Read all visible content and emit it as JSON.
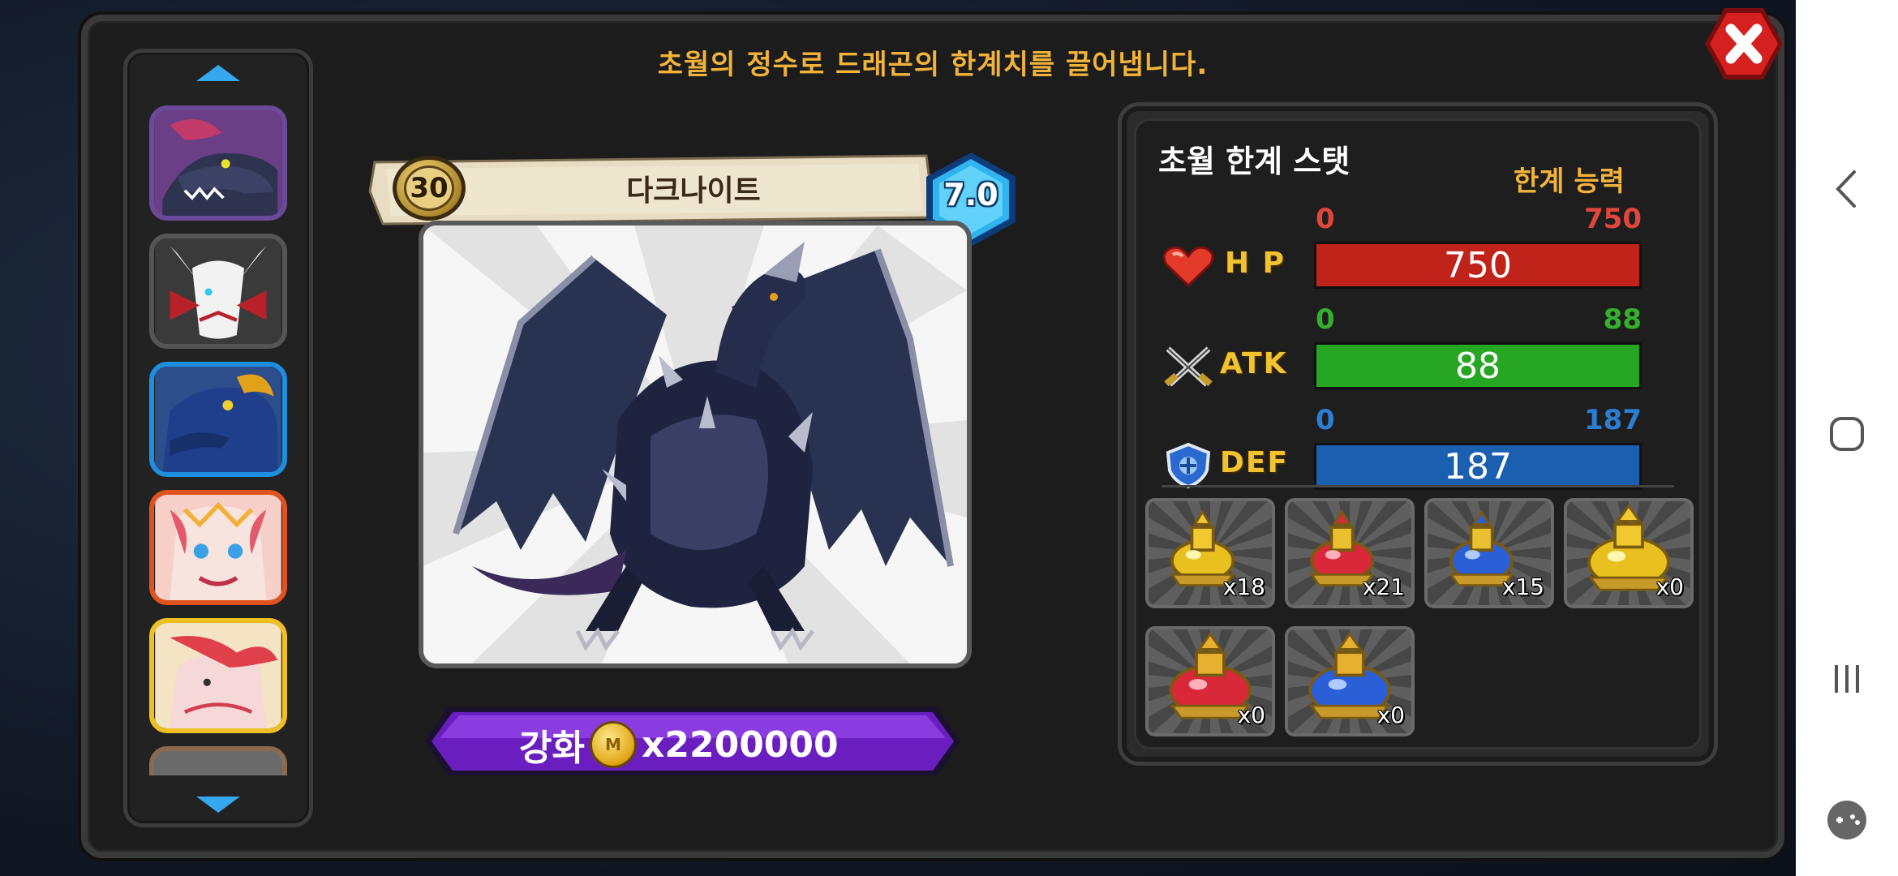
{
  "header": {
    "subtitle": "초월의 정수로 드래곤의 한계치를 끌어냅니다."
  },
  "dragon_list": {
    "items": [
      {
        "name": "dragon-portrait-1",
        "border": "#6b4a9a"
      },
      {
        "name": "dragon-portrait-2",
        "border": "#555555"
      },
      {
        "name": "dragon-portrait-3",
        "border": "#1e8fe0"
      },
      {
        "name": "dragon-portrait-4",
        "border": "#e0521e"
      },
      {
        "name": "dragon-portrait-5",
        "border": "#f0c020"
      }
    ]
  },
  "dragon": {
    "level": "30",
    "name": "다크나이트",
    "grade": "7.0"
  },
  "enhance": {
    "label": "강화",
    "coin_symbol": "M",
    "cost": "x2200000"
  },
  "stats": {
    "title": "초월 한계 스탯",
    "limit_title": "한계 능력",
    "rows": [
      {
        "label": "H P",
        "min": "0",
        "max": "750",
        "value": "750",
        "color": "#c0231a",
        "range_color": "#e0463a",
        "icon": "heart-icon"
      },
      {
        "label": "ATK",
        "min": "0",
        "max": "88",
        "value": "88",
        "color": "#27a623",
        "range_color": "#35b02c",
        "icon": "crossed-swords-icon"
      },
      {
        "label": "DEF",
        "min": "0",
        "max": "187",
        "value": "187",
        "color": "#1b5fb0",
        "range_color": "#2a7fd4",
        "icon": "shield-icon"
      }
    ]
  },
  "items": [
    {
      "qty": "x18",
      "gem": "#e8c020",
      "kind": "yellow-potion-icon"
    },
    {
      "qty": "x21",
      "gem": "#d8283a",
      "kind": "red-potion-icon"
    },
    {
      "qty": "x15",
      "gem": "#2a5fd8",
      "kind": "blue-potion-icon"
    },
    {
      "qty": "x0",
      "gem": "#e8c020",
      "kind": "large-yellow-potion-icon"
    },
    {
      "qty": "x0",
      "gem": "#d8283a",
      "kind": "large-red-potion-icon"
    },
    {
      "qty": "x0",
      "gem": "#2a5fd8",
      "kind": "large-blue-potion-icon"
    }
  ]
}
